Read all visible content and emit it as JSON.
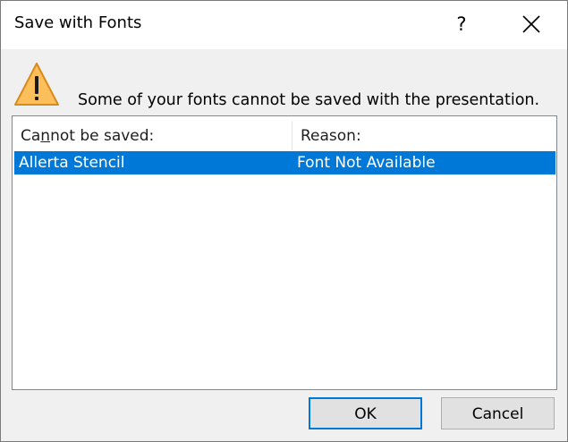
{
  "dialog": {
    "title": "Save with Fonts",
    "help_label": "?",
    "close_icon": "close-icon",
    "warning_icon": "warning-icon",
    "message": "Some of your fonts cannot be saved with the presentation."
  },
  "list": {
    "columns": [
      {
        "label_before": "Ca",
        "label_accel": "n",
        "label_after": "not be saved:"
      },
      {
        "label": "Reason:"
      }
    ],
    "rows": [
      {
        "name": "Allerta Stencil",
        "reason": "Font Not Available",
        "selected": true
      }
    ]
  },
  "buttons": {
    "ok": "OK",
    "cancel": "Cancel"
  },
  "colors": {
    "selection": "#0078d7",
    "warning_fill": "#fcbf5b",
    "warning_stroke": "#d98a1c",
    "button_face": "#e1e1e1",
    "dialog_bg": "#f0f0f0"
  }
}
